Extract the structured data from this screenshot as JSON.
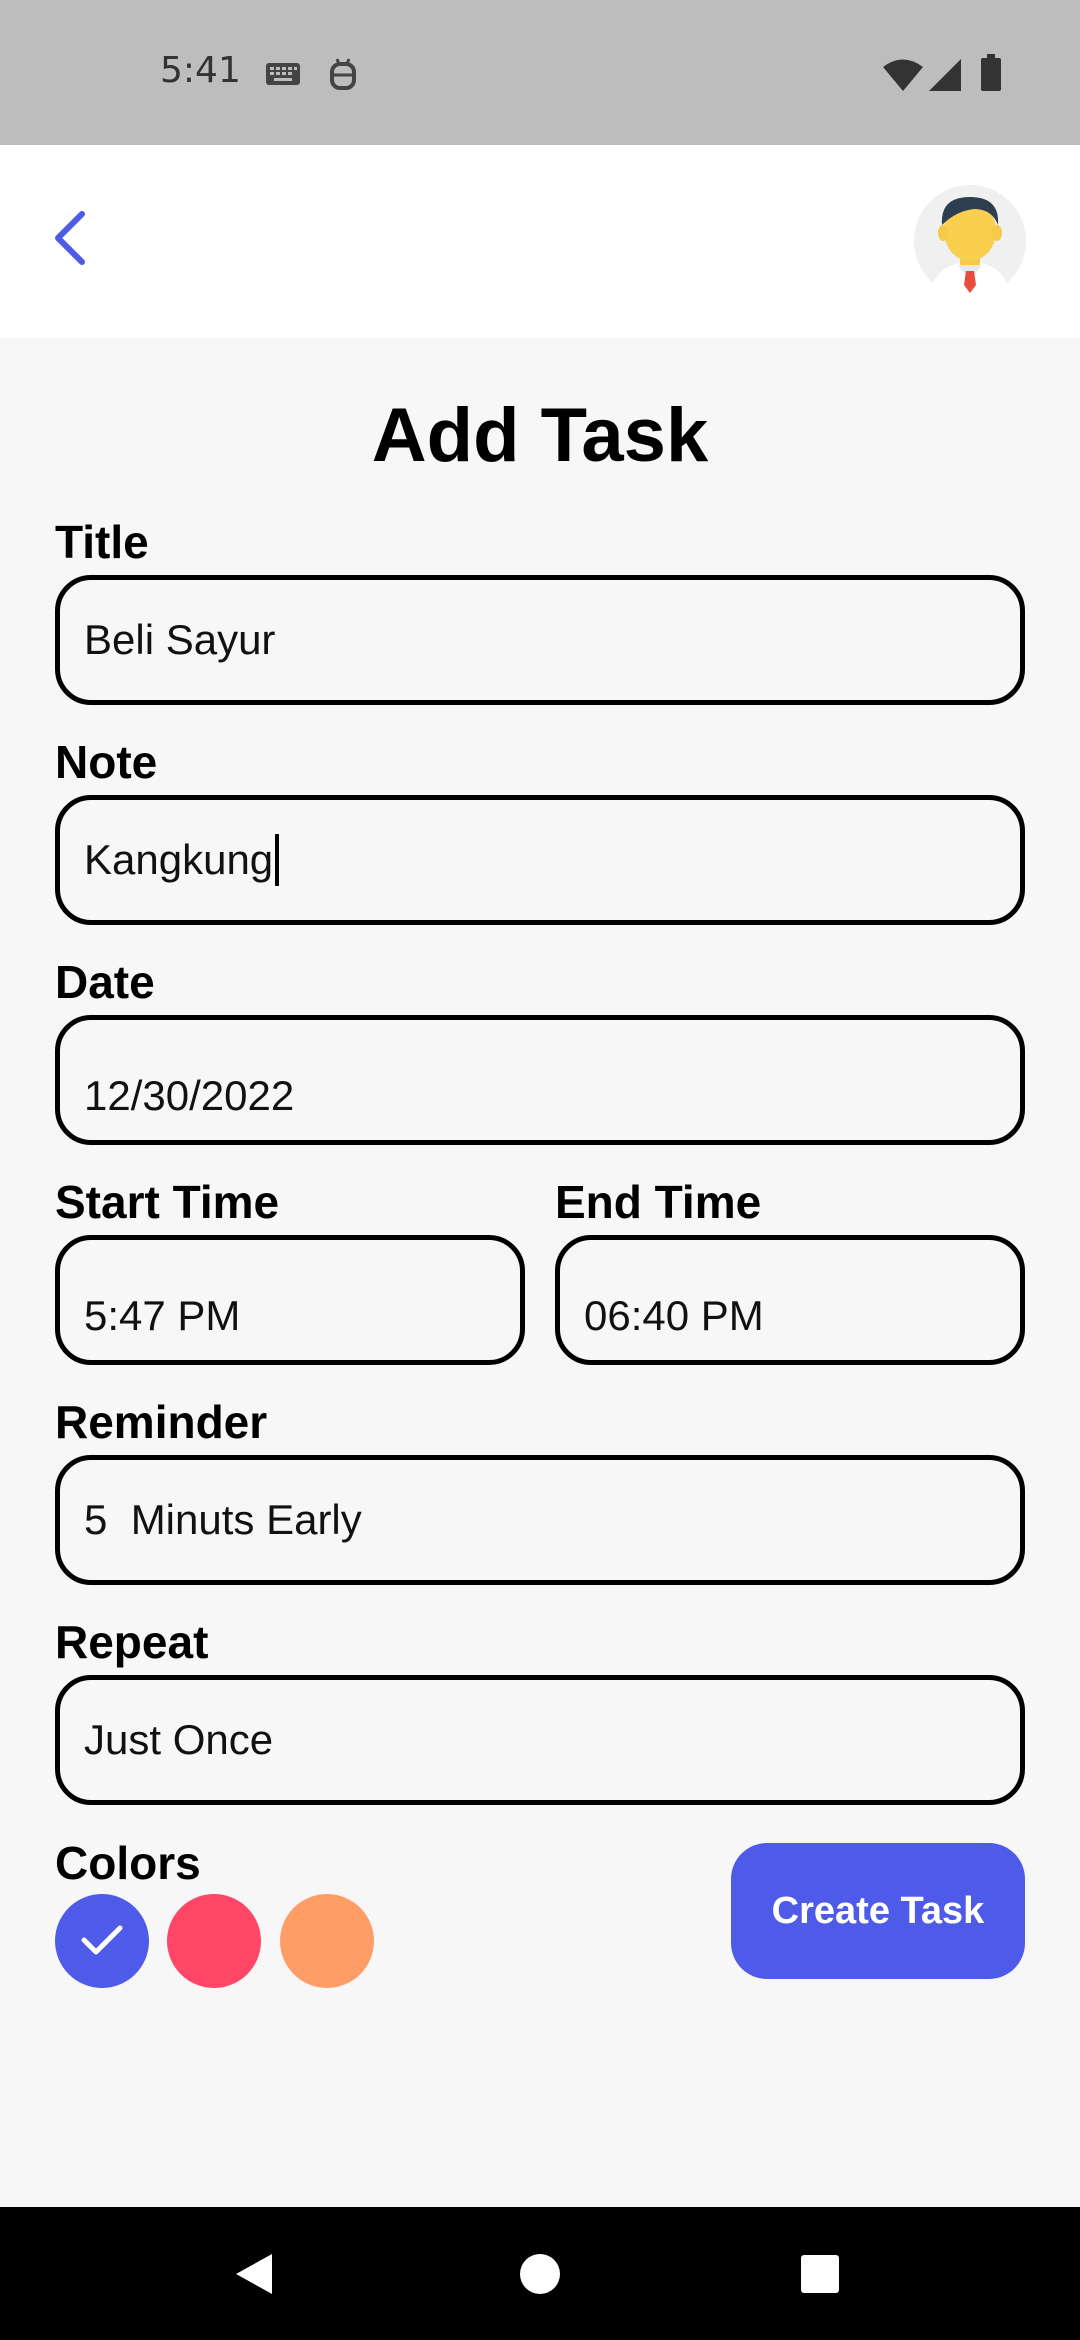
{
  "status_bar": {
    "time": "5:41",
    "icons": [
      "keyboard-icon",
      "android-debug-icon",
      "wifi-icon",
      "signal-icon",
      "battery-icon"
    ]
  },
  "app_bar": {
    "back_icon": "chevron-left-icon",
    "avatar": "user-avatar"
  },
  "page": {
    "title": "Add Task"
  },
  "form": {
    "title": {
      "label": "Title",
      "value": "Beli Sayur"
    },
    "note": {
      "label": "Note",
      "value": "Kangkung"
    },
    "date": {
      "label": "Date",
      "value": "12/30/2022"
    },
    "start_time": {
      "label": "Start Time",
      "value": "5:47 PM"
    },
    "end_time": {
      "label": "End Time",
      "value": "06:40 PM"
    },
    "reminder": {
      "label": "Reminder",
      "value": "5  Minuts Early"
    },
    "repeat": {
      "label": "Repeat",
      "value": "Just Once"
    }
  },
  "colors": {
    "label": "Colors",
    "options": [
      "#4e5ae8",
      "#ff4667",
      "#ff9d66"
    ],
    "selected_index": 0
  },
  "create_button": {
    "label": "Create Task"
  },
  "theme": {
    "accent": "#4e5ae8"
  },
  "nav_bar": {
    "icons": [
      "back-triangle-icon",
      "home-circle-icon",
      "recents-square-icon"
    ]
  }
}
